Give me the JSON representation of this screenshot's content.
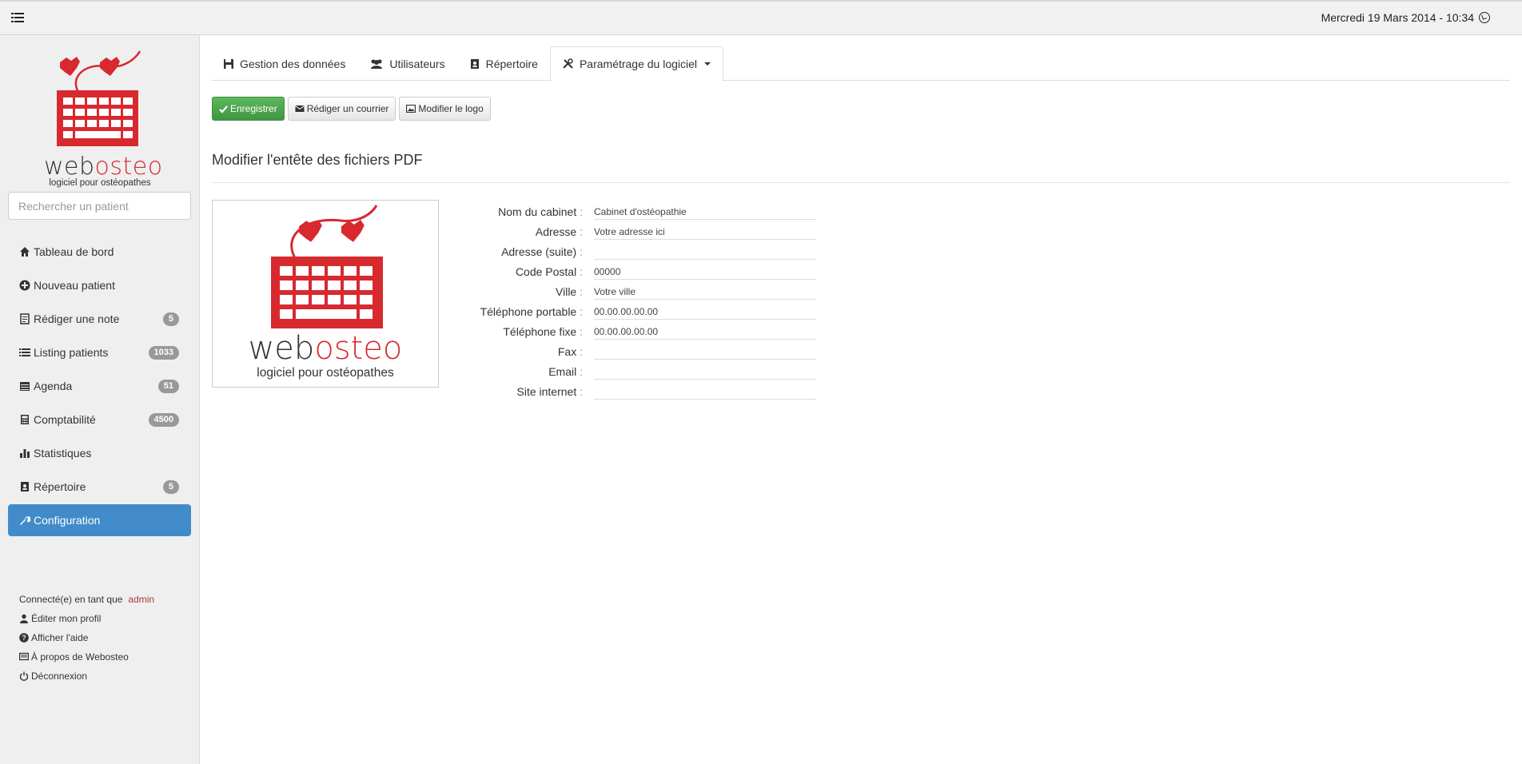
{
  "topbar": {
    "datetime": "Mercredi 19 Mars 2014 - 10:34"
  },
  "sidebar": {
    "logo": {
      "name_part1": "web",
      "name_part2": "osteo",
      "tagline": "logiciel pour ostéopathes"
    },
    "search_placeholder": "Rechercher un patient",
    "items": [
      {
        "label": "Tableau de bord",
        "icon": "home-icon",
        "badge": null
      },
      {
        "label": "Nouveau patient",
        "icon": "plus-circle-icon",
        "badge": null
      },
      {
        "label": "Rédiger une note",
        "icon": "note-icon",
        "badge": "5"
      },
      {
        "label": "Listing patients",
        "icon": "list-icon",
        "badge": "1033"
      },
      {
        "label": "Agenda",
        "icon": "calendar-icon",
        "badge": "51"
      },
      {
        "label": "Comptabilité",
        "icon": "calculator-icon",
        "badge": "4500"
      },
      {
        "label": "Statistiques",
        "icon": "bar-chart-icon",
        "badge": null
      },
      {
        "label": "Répertoire",
        "icon": "address-book-icon",
        "badge": "5"
      },
      {
        "label": "Configuration",
        "icon": "wrench-icon",
        "badge": null,
        "active": true
      }
    ],
    "user": {
      "connected_as": "Connecté(e) en tant que",
      "username": "admin",
      "links": [
        "Éditer mon profil",
        "Afficher l'aide",
        "À propos de Webosteo",
        "Déconnexion"
      ]
    }
  },
  "tabs": [
    {
      "label": "Gestion des données",
      "icon": "save-icon"
    },
    {
      "label": "Utilisateurs",
      "icon": "users-icon"
    },
    {
      "label": "Répertoire",
      "icon": "address-book-icon"
    },
    {
      "label": "Paramétrage du logiciel",
      "icon": "tools-icon",
      "active": true
    }
  ],
  "toolbar": {
    "save_label": "Enregistrer",
    "letter_label": "Rédiger un courrier",
    "logo_label": "Modifier le logo"
  },
  "section": {
    "title": "Modifier l'entête des fichiers PDF"
  },
  "logo_preview": {
    "name_part1": "web",
    "name_part2": "osteo",
    "tagline": "logiciel pour ostéopathes"
  },
  "form": [
    {
      "label": "Nom du cabinet",
      "value": "Cabinet d'ostéopathie"
    },
    {
      "label": "Adresse",
      "value": "Votre adresse ici"
    },
    {
      "label": "Adresse (suite)",
      "value": ""
    },
    {
      "label": "Code Postal",
      "value": "00000"
    },
    {
      "label": "Ville",
      "value": "Votre ville"
    },
    {
      "label": "Téléphone portable",
      "value": "00.00.00.00.00"
    },
    {
      "label": "Téléphone fixe",
      "value": "00.00.00.00.00"
    },
    {
      "label": "Fax",
      "value": ""
    },
    {
      "label": "Email",
      "value": ""
    },
    {
      "label": "Site internet",
      "value": ""
    }
  ],
  "colors": {
    "brand_red": "#d8292f",
    "primary": "#428bca",
    "success": "#5cb85c",
    "badge": "#999999"
  }
}
